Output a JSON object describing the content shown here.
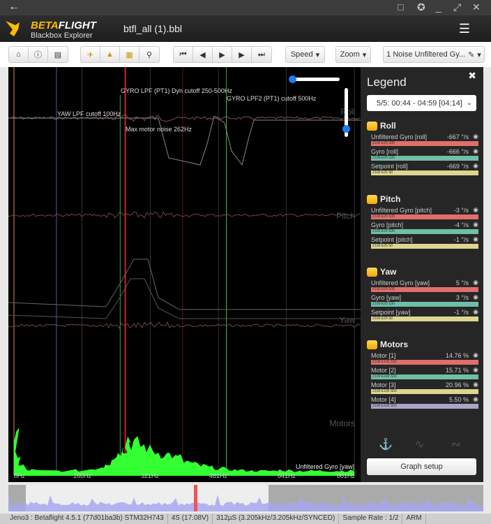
{
  "window": {
    "back_icon": "arrow-left-icon",
    "controls": [
      "screenshot-icon",
      "pin-icon",
      "minimize-icon",
      "maximize-icon",
      "close-icon"
    ]
  },
  "header": {
    "brand_main_a": "BETA",
    "brand_main_b": "FLIGHT",
    "brand_sub": "Blackbox Explorer",
    "filename": "btfl_all (1).bbl"
  },
  "toolbar": {
    "group1": [
      "home-icon",
      "info-icon",
      "log-icon"
    ],
    "group2": [
      "video-icon",
      "craft-icon",
      "sticks-icon",
      "map-marker-icon"
    ],
    "group3": [
      "jump-start-icon",
      "step-back-icon",
      "play-icon",
      "step-forward-icon",
      "jump-end-icon"
    ],
    "speed_label": "Speed",
    "zoom_label": "Zoom",
    "graph_select": "1 Noise Unfiltered Gy..."
  },
  "graph": {
    "annotations": {
      "yaw_lpf": "YAW LPF cutoff 100Hz",
      "gyro_lpf": "GYRO LPF (PT1) Dyn cutoff 250-500Hz",
      "gyro_lpf2": "GYRO LPF2 (PT1) cutoff 500Hz",
      "max_motor": "Max motor noise 262Hz",
      "series_label": "Unfiltered Gyro [yaw]"
    },
    "axis_labels": [
      "Roll",
      "Pitch",
      "Yaw",
      "Motors"
    ]
  },
  "chart_data": {
    "type": "area",
    "title": "",
    "xlabel": "",
    "ylabel": "",
    "xlim": [
      0,
      801
    ],
    "x_ticks": [
      "0Hz",
      "160Hz",
      "321Hz",
      "481Hz",
      "641Hz",
      "801Hz"
    ],
    "x_tick_values": [
      0,
      160,
      321,
      481,
      641,
      801
    ],
    "series": [
      {
        "name": "Unfiltered Gyro [yaw]",
        "color": "#33ff33",
        "x": [
          0,
          3,
          10,
          30,
          60,
          100,
          140,
          180,
          200,
          215,
          230,
          245,
          255,
          262,
          270,
          285,
          300,
          320,
          340,
          360,
          380,
          400,
          420,
          440,
          460,
          480,
          500,
          520,
          540,
          560,
          580,
          600,
          620,
          640,
          660,
          680,
          700,
          720,
          740,
          760,
          780,
          801
        ],
        "values": [
          9,
          5,
          2.2,
          1.2,
          1,
          1,
          1.1,
          1.4,
          2,
          3,
          4.5,
          6,
          7,
          9,
          8,
          7.5,
          7,
          6,
          5.5,
          5,
          4.2,
          3.2,
          2.6,
          2.2,
          1.8,
          1.6,
          1.3,
          1.2,
          1.1,
          1,
          1,
          1,
          1.2,
          1.1,
          1,
          1,
          1,
          1,
          1,
          1,
          1,
          1
        ]
      }
    ],
    "markers": [
      {
        "label": "YAW LPF cutoff 100Hz",
        "hz": 100,
        "color": "#5555aa"
      },
      {
        "label": "GYRO LPF (PT1) Dyn cutoff 250-500Hz",
        "hz": [
          250,
          500
        ],
        "color": "#33aa55"
      },
      {
        "label": "Max motor noise 262Hz",
        "hz": 262,
        "color": "#cc2222"
      },
      {
        "label": "GYRO LPF2 (PT1) cutoff 500Hz",
        "hz": 500,
        "color": "#33aa55"
      }
    ],
    "grid": true
  },
  "legend": {
    "title": "Legend",
    "close_icon": "close-icon",
    "range": "5/5: 00:44 - 04:59 [04:14]",
    "groups": [
      {
        "name": "Roll",
        "items": [
          {
            "label": "Unfiltered Gyro [roll]",
            "value": "-667 °/s",
            "tag": "Z100 E25 S30",
            "color": "#e06f6a"
          },
          {
            "label": "Gyro [roll]",
            "value": "-666 °/s",
            "tag": "Z100 E25 S30",
            "color": "#6fbfa8"
          },
          {
            "label": "Setpoint [roll]",
            "value": "-669 °/s",
            "tag": "Z100 E25 S0",
            "color": "#dcd690"
          }
        ]
      },
      {
        "name": "Pitch",
        "items": [
          {
            "label": "Unfiltered Gyro [pitch]",
            "value": "-3 °/s",
            "tag": "Z100 E25 S30",
            "color": "#e06f6a"
          },
          {
            "label": "Gyro [pitch]",
            "value": "-4 °/s",
            "tag": "Z100 E25 S30",
            "color": "#6fbfa8"
          },
          {
            "label": "Setpoint [pitch]",
            "value": "-1 °/s",
            "tag": "Z100 E25 S0",
            "color": "#dcd690"
          }
        ]
      },
      {
        "name": "Yaw",
        "items": [
          {
            "label": "Unfiltered Gyro [yaw]",
            "value": "5 °/s",
            "tag": "Z100 E25 S30",
            "color": "#e06f6a"
          },
          {
            "label": "Gyro [yaw]",
            "value": "3 °/s",
            "tag": "Z100 E25 S30",
            "color": "#6fbfa8"
          },
          {
            "label": "Setpoint [yaw]",
            "value": "-1 °/s",
            "tag": "Z100 E25 S0",
            "color": "#dcd690"
          }
        ]
      },
      {
        "name": "Motors",
        "items": [
          {
            "label": "Motor [1]",
            "value": "14.76 %",
            "tag": "Z100 E100 S30",
            "color": "#e06f6a"
          },
          {
            "label": "Motor [2]",
            "value": "15.71 %",
            "tag": "Z100 E100 S30",
            "color": "#6fbfa8"
          },
          {
            "label": "Motor [3]",
            "value": "20.96 %",
            "tag": "Z100 E100 S50",
            "color": "#dcd690"
          },
          {
            "label": "Motor [4]",
            "value": "5.50 %",
            "tag": "Z100 E100 S50",
            "color": "#a8a3c8"
          }
        ]
      }
    ],
    "graph_setup": "Graph setup"
  },
  "status": {
    "items": [
      "Jeno3 : Betaflight 4.5.1 (77d01ba3b) STM32H743",
      "4S (17.08V)",
      "312µS (3.205kHz/3.205kHz/SYNCED)",
      "Sample Rate : 1/2",
      "ARM"
    ]
  }
}
